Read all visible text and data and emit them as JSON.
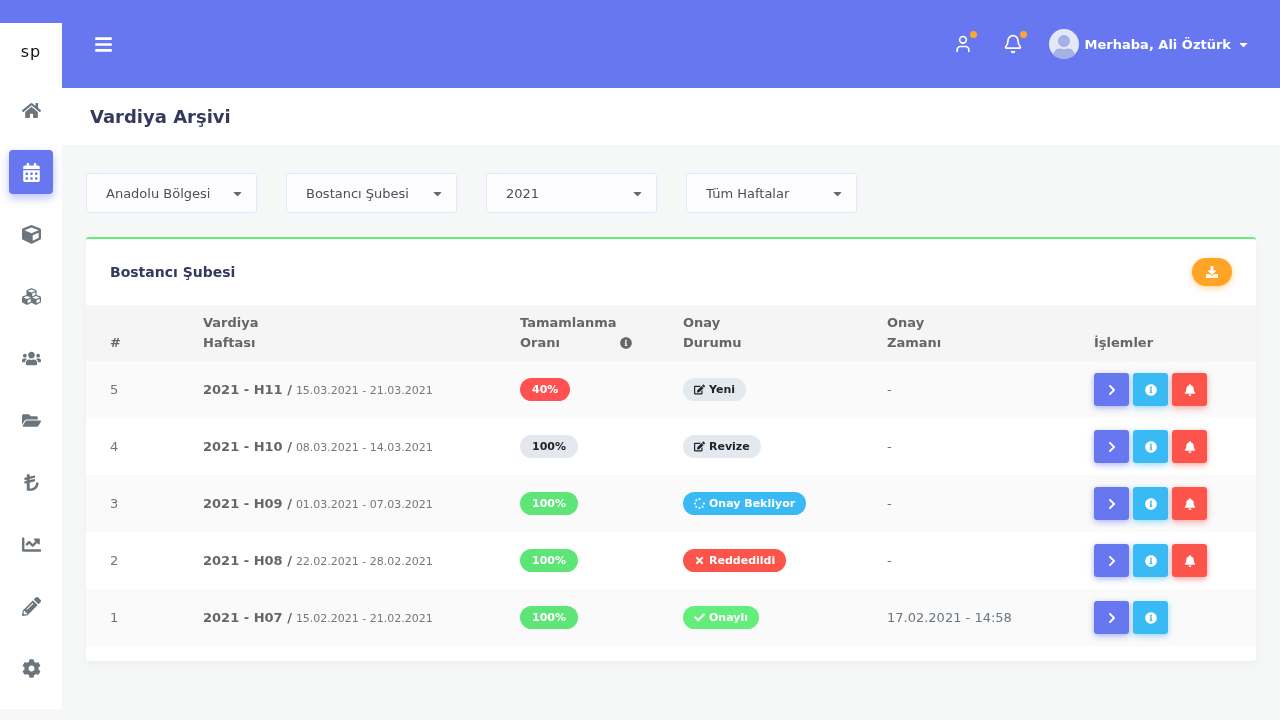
{
  "brand": "sp",
  "sidebar": {
    "items": [
      {
        "selected": false
      },
      {
        "selected": true
      },
      {
        "selected": false
      },
      {
        "selected": false
      },
      {
        "selected": false
      },
      {
        "selected": false
      },
      {
        "selected": false
      },
      {
        "selected": false
      },
      {
        "selected": false
      },
      {
        "selected": false
      }
    ]
  },
  "header": {
    "icons": [
      {
        "badge": true
      },
      {
        "badge": true
      }
    ],
    "greeting": "Merhaba, Ali Öztürk"
  },
  "page_title": "Vardiya Arşivi",
  "filters": [
    {
      "value": "Anadolu Bölgesi"
    },
    {
      "value": "Bostancı Şubesi"
    },
    {
      "value": "2021"
    },
    {
      "value": "Tüm Haftalar"
    }
  ],
  "card": {
    "title": "Bostancı Şubesi",
    "table": {
      "columns": [
        {
          "label": "#",
          "info": false
        },
        {
          "label": "Vardiya Haftası",
          "info": false
        },
        {
          "label": "Tamamlanma Oranı",
          "info": true
        },
        {
          "label": "Onay Durumu",
          "info": false
        },
        {
          "label": "Onay Zamanı",
          "info": false
        },
        {
          "label": "İşlemler",
          "info": false
        }
      ],
      "rows": [
        {
          "number": "5",
          "week": "2021 - H11 /",
          "dates": "15.03.2021 - 21.03.2021",
          "rate": "40%",
          "color": "#ff5151",
          "status": {
            "kind": "new",
            "label": "Yeni"
          },
          "approved_at": "-",
          "actions": [
            {
              "kind": "open"
            },
            {
              "kind": "info"
            },
            {
              "kind": "notify"
            }
          ]
        },
        {
          "number": "4",
          "week": "2021 - H10 /",
          "dates": "08.03.2021 - 14.03.2021",
          "rate": "100%",
          "color": "#e4e8ee",
          "status": {
            "kind": "revise",
            "label": "Revize"
          },
          "approved_at": "-",
          "actions": [
            {
              "kind": "open"
            },
            {
              "kind": "info"
            },
            {
              "kind": "notify"
            }
          ]
        },
        {
          "number": "3",
          "week": "2021 - H09 /",
          "dates": "01.03.2021 - 07.03.2021",
          "rate": "100%",
          "color": "#5de578",
          "status": {
            "kind": "pending",
            "label": "Onay Bekliyor"
          },
          "approved_at": "-",
          "actions": [
            {
              "kind": "open"
            },
            {
              "kind": "info"
            },
            {
              "kind": "notify"
            }
          ]
        },
        {
          "number": "2",
          "week": "2021 - H08 /",
          "dates": "22.02.2021 - 28.02.2021",
          "rate": "100%",
          "color": "#5de578",
          "status": {
            "kind": "rejected",
            "label": "Reddedildi"
          },
          "approved_at": "-",
          "actions": [
            {
              "kind": "open"
            },
            {
              "kind": "info"
            },
            {
              "kind": "notify"
            }
          ]
        },
        {
          "number": "1",
          "week": "2021 - H07 /",
          "dates": "15.02.2021 - 21.02.2021",
          "rate": "100%",
          "color": "#5de578",
          "status": {
            "kind": "approved",
            "label": "Onaylı"
          },
          "approved_at": "17.02.2021 - 14:58",
          "actions": [
            {
              "kind": "open"
            },
            {
              "kind": "info"
            }
          ]
        }
      ]
    }
  }
}
